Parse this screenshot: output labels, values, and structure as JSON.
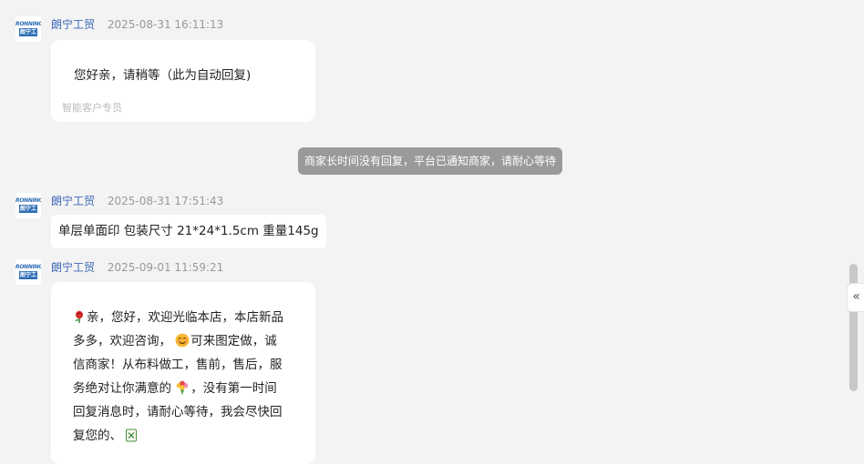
{
  "messages": [
    {
      "sender": "朗宁工贸",
      "time": "2025-08-31 16:11:13",
      "text": "您好亲，请稍等（此为自动回复)",
      "footer": "智能客户专员"
    },
    {
      "sender": "朗宁工贸",
      "time": "2025-08-31 17:51:43",
      "text": "单层单面印 包装尺寸 21*24*1.5cm 重量145g"
    },
    {
      "sender": "朗宁工贸",
      "time": "2025-09-01 11:59:21",
      "lines": [
        "亲，您好，欢迎光临本店，本店新品",
        "多多，欢迎咨询，",
        "可来图定做，诚",
        "信商家！从布料做工，售前，售后，服",
        "务绝对让你满意的",
        "，没有第一时间",
        "回复消息时，请耐心等待，我会尽快回",
        "复您的、"
      ]
    }
  ],
  "system_notice": "商家长时间没有回复，平台已通知商家，请耐心等待",
  "avatar": {
    "logo_top": "RONNING",
    "logo_bottom": "朗宁工贸"
  },
  "icons": {
    "collapse": "double-chevron-left",
    "emoji_1": "rose-icon",
    "emoji_2": "smiling-face-icon",
    "emoji_3": "bouquet-icon",
    "emoji_4": "mahjong-tile-icon"
  },
  "colors": {
    "background": "#f3f3f3",
    "sender_name": "#3a66b8",
    "timestamp": "#999999",
    "system_notice_bg": "#9a9a9a"
  },
  "collapse_glyph": "«"
}
